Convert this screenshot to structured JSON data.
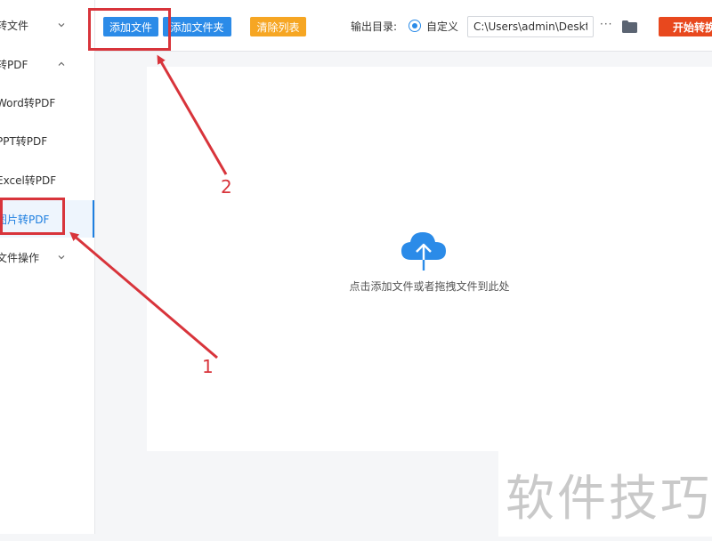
{
  "sidebar": {
    "items": [
      {
        "label": "转文件",
        "chevron": "down"
      },
      {
        "label": "转PDF",
        "chevron": "up"
      },
      {
        "label": "Word转PDF"
      },
      {
        "label": "PPT转PDF"
      },
      {
        "label": "Excel转PDF"
      },
      {
        "label": "图片转PDF",
        "active": true
      },
      {
        "label": "文件操作",
        "chevron": "down"
      }
    ]
  },
  "toolbar": {
    "add_file": "添加文件",
    "add_folder": "添加文件夹",
    "clear_list": "清除列表",
    "output_label": "输出目录:",
    "radio_label": "自定义",
    "output_path": "C:\\Users\\admin\\Deskto",
    "more": "···",
    "start": "开始转换"
  },
  "dropzone": {
    "hint": "点击添加文件或者拖拽文件到此处"
  },
  "annotations": {
    "label_1": "1",
    "label_2": "2"
  },
  "watermark": "软件技巧",
  "colors": {
    "accent": "#2b8be8",
    "orange": "#f6a623",
    "start_red": "#e8481e",
    "annotation_red": "#d8343b"
  },
  "icons": {
    "upload": "cloud-upload-icon",
    "folder": "folder-icon",
    "chevron_down": "chevron-down-icon",
    "chevron_up": "chevron-up-icon"
  }
}
